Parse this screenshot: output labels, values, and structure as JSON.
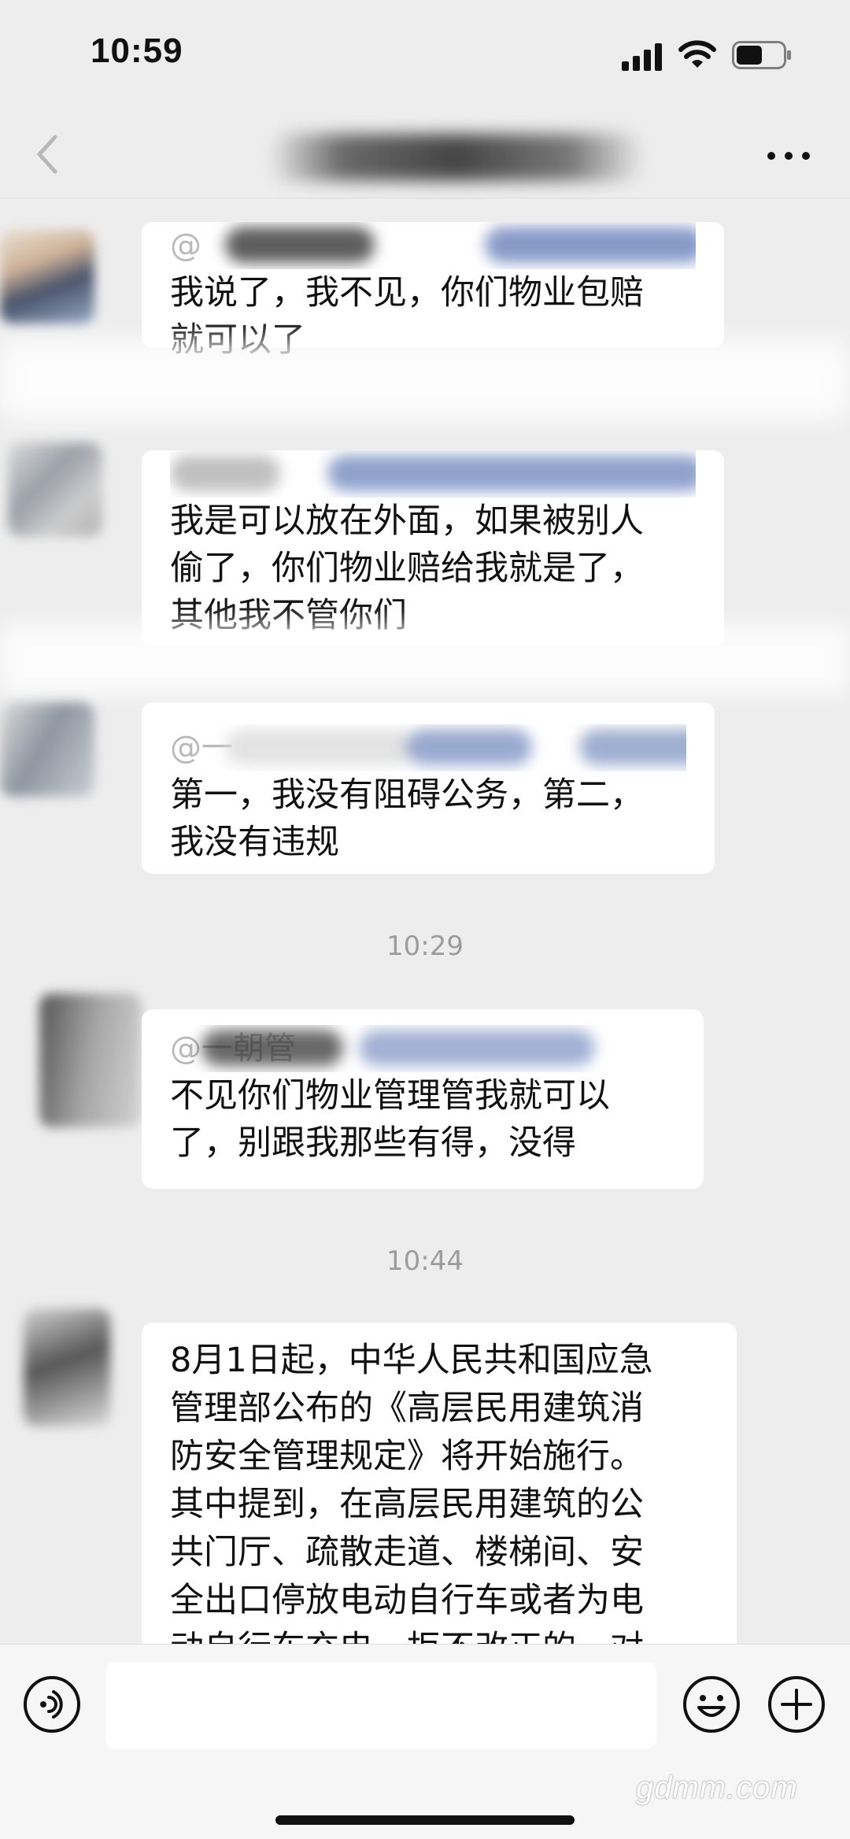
{
  "status_bar": {
    "time": "10:59"
  },
  "messages": [
    {
      "mention": "@",
      "text": "我说了，我不见，你们物业包赔\n就可以了"
    },
    {
      "mention": "",
      "text": "我是可以放在外面，如果被别人\n偷了，你们物业赔给我就是了，\n其他我不管你们"
    },
    {
      "mention": "@一",
      "text": "第一，我没有阻碍公务，第二，\n我没有违规"
    },
    {
      "mention": "@一朝管",
      "text": "不见你们物业管理管我就可以\n了，别跟我那些有得，没得"
    },
    {
      "mention": "",
      "text": "8月1日起，中华人民共和国应急\n管理部公布的《高层民用建筑消\n防安全管理规定》将开始施行。\n其中提到，在高层民用建筑的公\n共门厅、疏散走道、楼梯间、安\n全出口停放电动自行车或者为电\n动自行车充电，拒不改正的，对"
    }
  ],
  "time_dividers": [
    "10:29",
    "10:44"
  ],
  "input": {
    "value": ""
  },
  "watermark": "gdmm.com"
}
